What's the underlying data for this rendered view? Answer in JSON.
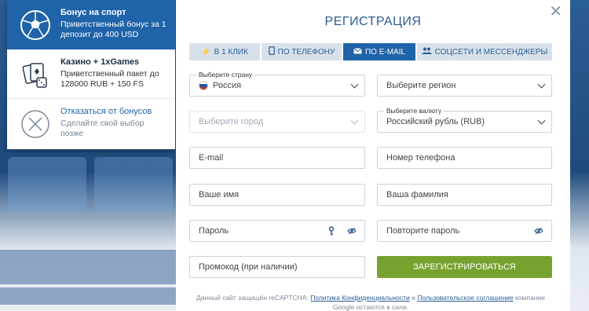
{
  "bonus_panel": {
    "items": [
      {
        "title": "Бонус на спорт",
        "text": "Приветственный бонус за 1 депозит до 400 USD",
        "icon": "soccer-ball-icon"
      },
      {
        "title": "Казино + 1xGames",
        "text": "Приветственный пакет до 128000 RUB + 150 FS",
        "icon": "cards-dice-icon"
      },
      {
        "title": "Отказаться от бонусов",
        "text": "Сделайте свой выбор позже",
        "icon": "cancel-circle-icon"
      }
    ]
  },
  "modal": {
    "title": "РЕГИСТРАЦИЯ",
    "close_icon": "close-icon",
    "tabs": [
      {
        "label": "В 1 КЛИК",
        "icon": "lightning-icon"
      },
      {
        "label": "ПО ТЕЛЕФОНУ",
        "icon": "phone-icon"
      },
      {
        "label": "ПО E-MAIL",
        "icon": "envelope-icon",
        "active": true
      },
      {
        "label": "СОЦСЕТИ И МЕССЕНДЖЕРЫ",
        "icon": "users-icon"
      }
    ],
    "fields": {
      "country": {
        "caption": "Выберите страну",
        "value": "Россия"
      },
      "region": {
        "placeholder": "Выберите регион"
      },
      "city": {
        "placeholder": "Выберите город"
      },
      "currency": {
        "caption": "Выберите валюту",
        "value": "Российский рубль (RUB)"
      },
      "email": {
        "placeholder": "E-mail"
      },
      "phone": {
        "placeholder": "Номер телефона"
      },
      "first_name": {
        "placeholder": "Ваше имя"
      },
      "last_name": {
        "placeholder": "Ваша фамилия"
      },
      "password": {
        "placeholder": "Пароль"
      },
      "password_repeat": {
        "placeholder": "Повторите пароль"
      },
      "promo": {
        "placeholder": "Промокод (при наличии)"
      }
    },
    "submit_label": "ЗАРЕГИСТРИРОВАТЬСЯ",
    "legal": {
      "prefix": "Данный сайт защищён reCAPTCHA: ",
      "privacy_link": "Политика Конфиденциальности",
      "and": " и ",
      "terms_link": "Пользовательское соглашение",
      "suffix": " компании Google остаются в силе."
    }
  },
  "colors": {
    "accent_blue": "#1f63a8",
    "submit_green": "#78a22f",
    "title_blue": "#2a5d93"
  }
}
